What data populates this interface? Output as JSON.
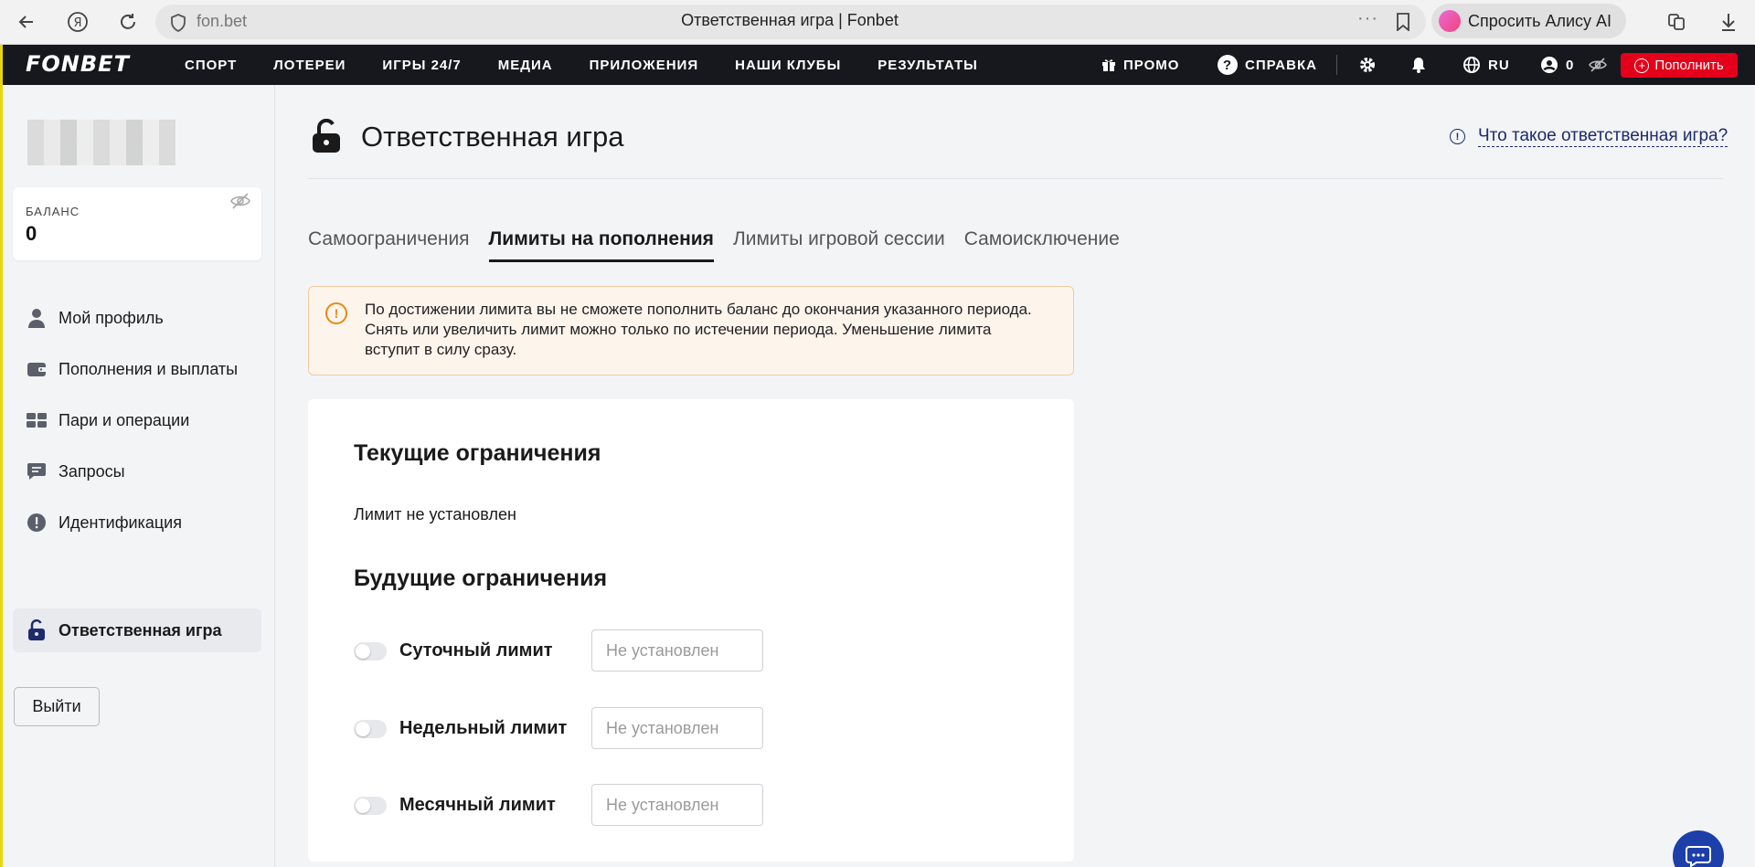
{
  "browser": {
    "domain": "fon.bet",
    "tab_title": "Ответственная игра | Fonbet",
    "alisa_label": "Спросить Алису AI"
  },
  "header": {
    "logo": "FONBET",
    "nav": [
      "СПОРТ",
      "ЛОТЕРЕИ",
      "ИГРЫ 24/7",
      "МЕДИА",
      "ПРИЛОЖЕНИЯ",
      "НАШИ КЛУБЫ",
      "РЕЗУЛЬТАТЫ"
    ],
    "promo": "ПРОМО",
    "help": "СПРАВКА",
    "lang": "RU",
    "account_balance": "0",
    "topup": "Пополнить"
  },
  "sidebar": {
    "balance_label": "БАЛАНС",
    "balance_value": "0",
    "items": [
      {
        "label": "Мой профиль",
        "icon": "user-icon"
      },
      {
        "label": "Пополнения и выплаты",
        "icon": "wallet-icon"
      },
      {
        "label": "Пари и операции",
        "icon": "tickets-icon"
      },
      {
        "label": "Запросы",
        "icon": "message-icon"
      },
      {
        "label": "Идентификация",
        "icon": "alert-icon"
      },
      {
        "label": "Ответственная игра",
        "icon": "lock-icon",
        "active": true
      }
    ],
    "logout": "Выйти"
  },
  "main": {
    "title": "Ответственная игра",
    "what_link": "Что такое ответственная игра?",
    "tabs": [
      {
        "label": "Самоограничения"
      },
      {
        "label": "Лимиты на пополнения",
        "active": true
      },
      {
        "label": "Лимиты игровой сессии"
      },
      {
        "label": "Самоисключение"
      }
    ],
    "notice": "По достижении лимита вы не сможете пополнить баланс до окончания указанного периода. Снять или увеличить лимит можно только по истечении периода. Уменьшение лимита вступит в силу сразу.",
    "current_heading": "Текущие ограничения",
    "current_value": "Лимит не установлен",
    "future_heading": "Будущие ограничения",
    "limits": [
      {
        "label": "Суточный лимит",
        "placeholder": "Не установлен",
        "enabled": false
      },
      {
        "label": "Недельный лимит",
        "placeholder": "Не установлен",
        "enabled": false
      },
      {
        "label": "Месячный лимит",
        "placeholder": "Не установлен",
        "enabled": false
      }
    ]
  },
  "colors": {
    "header_bg": "#16181d",
    "topup_bg": "#e4001b",
    "link": "#1d2a6b",
    "notice_bg": "#fdf4ec",
    "notice_accent": "#e98a12",
    "chat_bg": "#1d3faa"
  }
}
